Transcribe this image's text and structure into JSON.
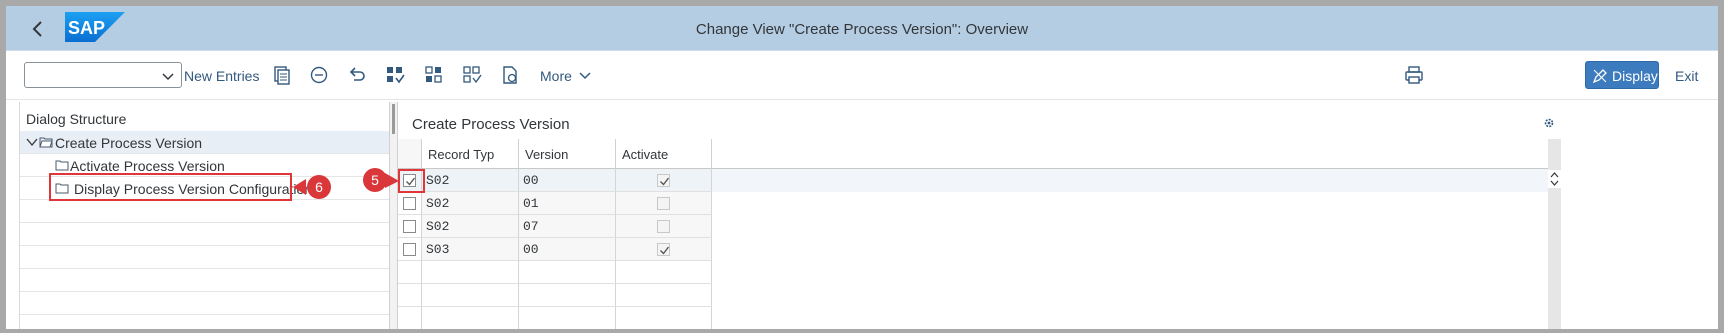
{
  "shell": {
    "title": "Change View \"Create Process Version\": Overview",
    "logo_text": "SAP",
    "back_icon": "chevron-left-icon"
  },
  "toolbar": {
    "combo_value": "",
    "new_entries": "New Entries",
    "more": "More",
    "display": "Display",
    "exit": "Exit",
    "icons": [
      "copy-icon",
      "delete-icon",
      "undo-icon",
      "select-all-icon",
      "select-block-icon",
      "deselect-all-icon",
      "export-icon",
      "print-icon"
    ]
  },
  "dialog_structure": {
    "title": "Dialog Structure",
    "items": [
      {
        "label": "Create Process Version",
        "level": 0,
        "expanded": true,
        "selected": true
      },
      {
        "label": "Activate Process Version",
        "level": 1
      },
      {
        "label": "Display Process Version Configuration",
        "level": 1
      }
    ]
  },
  "table": {
    "title": "Create Process Version",
    "columns": [
      "Record Typ",
      "Version",
      "Activate"
    ],
    "rows": [
      {
        "selected": true,
        "record_type": "S02",
        "version": "00",
        "activate": true
      },
      {
        "selected": false,
        "record_type": "S02",
        "version": "01",
        "activate": false
      },
      {
        "selected": false,
        "record_type": "S02",
        "version": "07",
        "activate": false
      },
      {
        "selected": false,
        "record_type": "S03",
        "version": "00",
        "activate": true
      }
    ]
  },
  "annotations": {
    "step5": "5",
    "step6": "6",
    "color": "#d9373a"
  },
  "colors": {
    "shell_bg": "#b5cde3",
    "accent": "#3c7bbd",
    "link": "#32597e"
  }
}
